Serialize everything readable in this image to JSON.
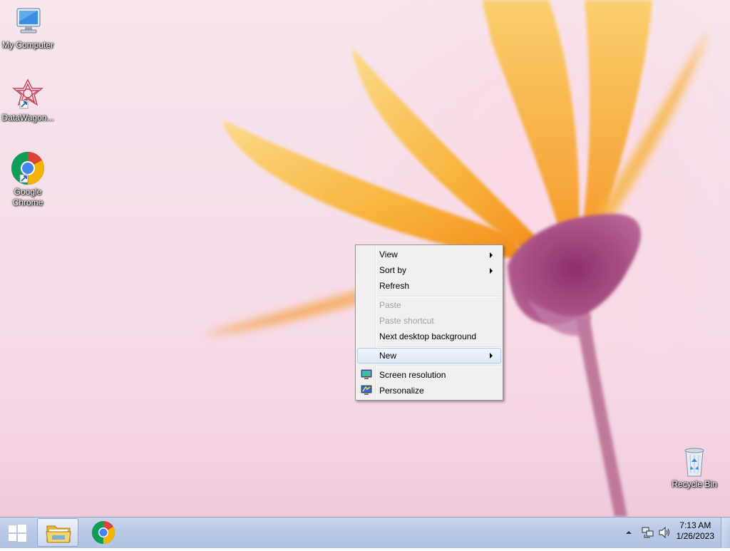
{
  "desktop": {
    "icons": [
      {
        "label": "My Computer",
        "icon": "computer-icon"
      },
      {
        "label": "DataWagon...",
        "icon": "datawagon-icon"
      },
      {
        "label": "Google Chrome",
        "icon": "chrome-icon"
      },
      {
        "label": "Recycle Bin",
        "icon": "recycle-bin-icon"
      }
    ]
  },
  "context_menu": {
    "items": [
      {
        "label": "View",
        "submenu": true,
        "enabled": true
      },
      {
        "label": "Sort by",
        "submenu": true,
        "enabled": true
      },
      {
        "label": "Refresh",
        "enabled": true
      },
      {
        "label": "Paste",
        "enabled": false
      },
      {
        "label": "Paste shortcut",
        "enabled": false
      },
      {
        "label": "Next desktop background",
        "enabled": true
      },
      {
        "label": "New",
        "submenu": true,
        "enabled": true,
        "highlighted": true
      },
      {
        "label": "Screen resolution",
        "enabled": true,
        "icon": "screen-resolution-icon"
      },
      {
        "label": "Personalize",
        "enabled": true,
        "icon": "personalize-icon"
      }
    ]
  },
  "taskbar": {
    "start_icon": "windows-logo-icon",
    "pinned": [
      {
        "name": "File Explorer",
        "icon": "folder-icon",
        "active": true
      },
      {
        "name": "Google Chrome",
        "icon": "chrome-icon",
        "active": false
      }
    ],
    "tray_icons": [
      "show-hidden-icons-chevron",
      "network-icon",
      "volume-icon"
    ],
    "clock": {
      "time": "7:13 AM",
      "date": "1/26/2023"
    }
  },
  "colors": {
    "taskbar": "#b9c9e6",
    "menu_bg": "#f0f0f0",
    "menu_highlight": "#dfeaf8",
    "disabled_text": "#a0a0a0"
  }
}
